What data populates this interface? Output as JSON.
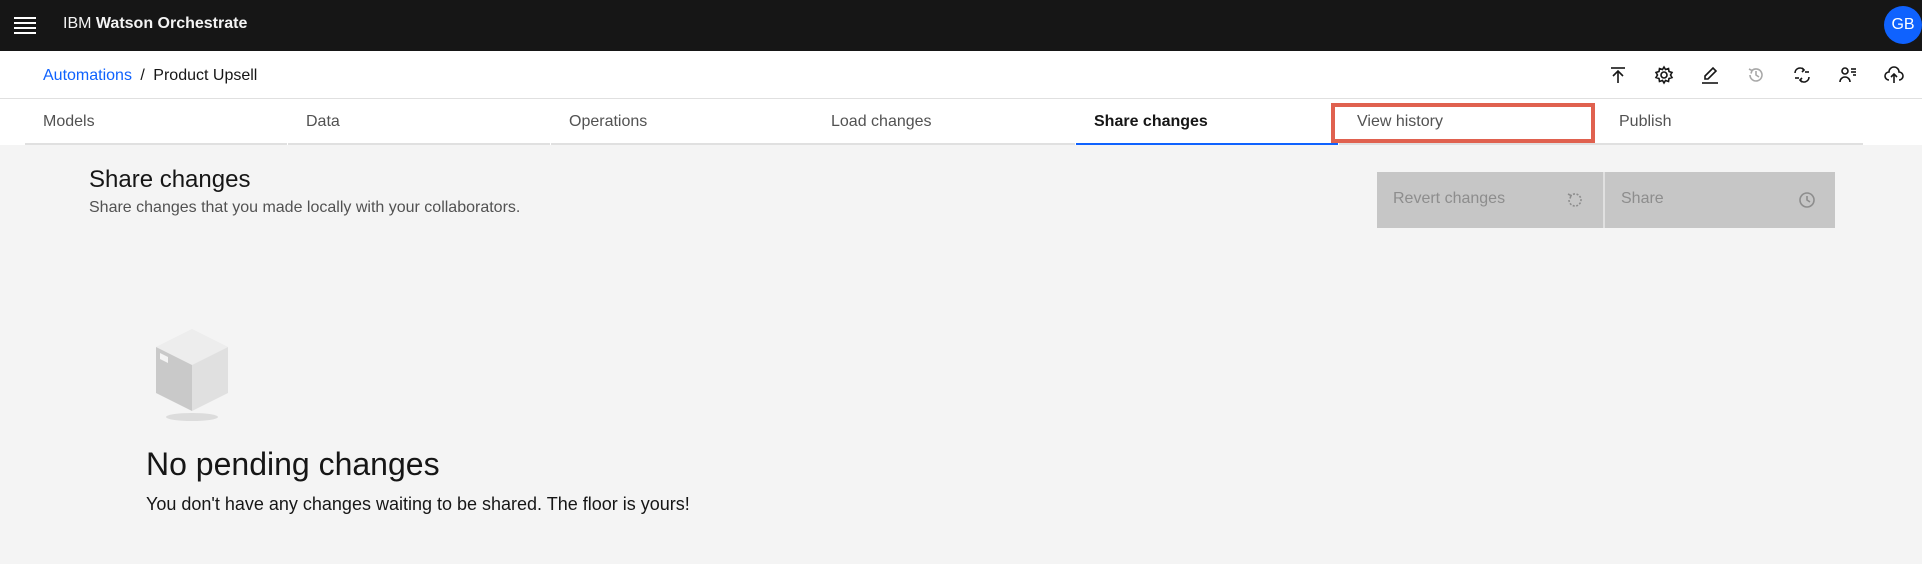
{
  "header": {
    "brand_prefix": "IBM",
    "brand_name": "Watson Orchestrate",
    "avatar_initials": "GB"
  },
  "breadcrumb": {
    "parent": "Automations",
    "separator": "/",
    "current": "Product Upsell"
  },
  "toolbar": {
    "icons": [
      "export-icon",
      "settings-icon",
      "edit-icon",
      "history-icon",
      "translate-icon",
      "user-list-icon",
      "upload-cloud-icon"
    ]
  },
  "tabs": [
    {
      "label": "Models"
    },
    {
      "label": "Data"
    },
    {
      "label": "Operations"
    },
    {
      "label": "Load changes"
    },
    {
      "label": "Share changes",
      "active": true
    },
    {
      "label": "View history",
      "highlighted": true
    },
    {
      "label": "Publish"
    }
  ],
  "main": {
    "title": "Share changes",
    "subtitle": "Share changes that you made locally with your collaborators.",
    "revert_label": "Revert changes",
    "share_label": "Share",
    "empty_title": "No pending changes",
    "empty_text": "You don't have any changes waiting to be shared. The floor is yours!"
  },
  "colors": {
    "accent": "#0f62fe",
    "highlight": "#e0614f",
    "header_bg": "#161616"
  }
}
